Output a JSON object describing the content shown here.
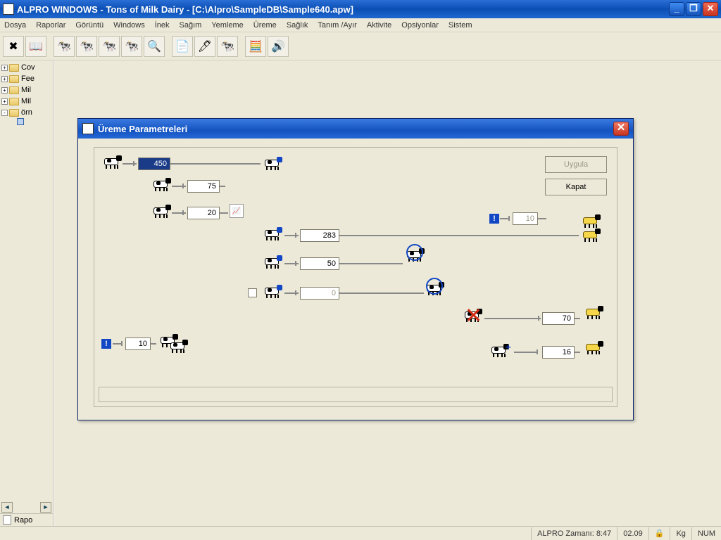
{
  "window": {
    "title": "ALPRO WINDOWS - Tons of Milk Dairy - [C:\\Alpro\\SampleDB\\Sample640.apw]"
  },
  "menu": {
    "items": [
      "Dosya",
      "Raporlar",
      "Görüntü",
      "Windows",
      "İnek",
      "Sağım",
      "Yemleme",
      "Üreme",
      "Sağlık",
      "Tanım /Ayır",
      "Aktivite",
      "Opsiyonlar",
      "Sistem"
    ]
  },
  "sidebar": {
    "items": [
      {
        "label": "Cov",
        "expandable": true,
        "sign": "+"
      },
      {
        "label": "Fee",
        "expandable": true,
        "sign": "+"
      },
      {
        "label": "Mil",
        "expandable": true,
        "sign": "+"
      },
      {
        "label": "Mil",
        "expandable": true,
        "sign": "+"
      },
      {
        "label": "örn",
        "expandable": true,
        "sign": "-"
      }
    ],
    "report_link": "Rapo"
  },
  "dialog": {
    "title": "Üreme Parametreleri",
    "apply": "Uygula",
    "close": "Kapat",
    "values": {
      "v450": "450",
      "v75": "75",
      "v20": "20",
      "v283": "283",
      "v50": "50",
      "v0": "0",
      "v10a": "10",
      "v10b": "10",
      "v70": "70",
      "v16": "16"
    }
  },
  "status": {
    "time": "ALPRO Zamanı: 8:47",
    "num": "02.09",
    "kg": "Kg",
    "numlock": "NUM"
  }
}
